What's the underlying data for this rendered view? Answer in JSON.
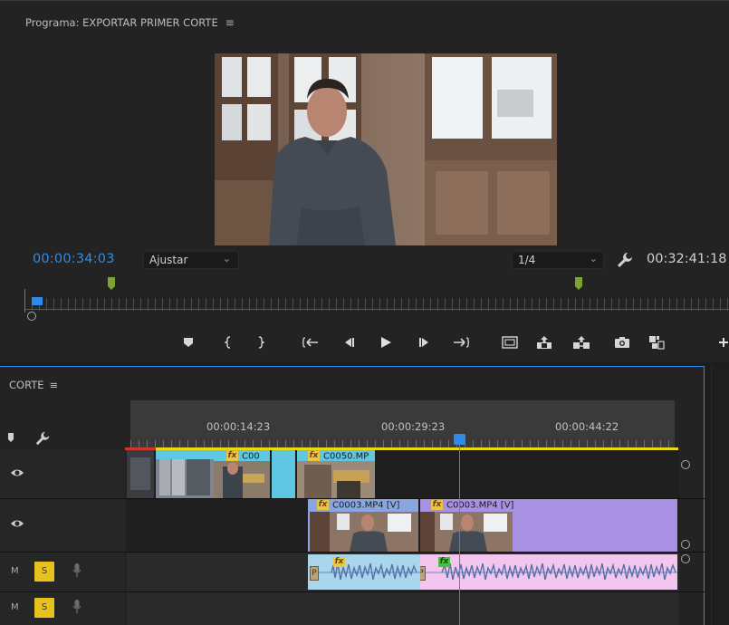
{
  "program_monitor": {
    "title": "Programa: EXPORTAR PRIMER CORTE",
    "menu_icon": "≡",
    "current_timecode": "00:00:34:03",
    "fit_value": "Ajustar",
    "resolution_value": "1/4",
    "duration_timecode": "00:32:41:18"
  },
  "transport": {
    "icons": [
      "add-marker-icon",
      "mark-in-icon",
      "mark-out-icon",
      "go-to-in-icon",
      "step-back-icon",
      "play-icon",
      "step-forward-icon",
      "go-to-out-icon",
      "safe-margins-icon",
      "lift-icon",
      "extract-icon",
      "export-frame-icon",
      "button-editor-icon",
      "add-icon"
    ]
  },
  "timeline": {
    "title": "CORTE",
    "menu_icon": "≡",
    "ruler_labels": [
      "00:00:14:23",
      "00:00:29:23",
      "00:00:44:22"
    ],
    "video_clips_v2": [
      "C00",
      "C0050.MP"
    ],
    "video_clips_v1": [
      "C0003.MP4 [V]",
      "C0003.MP4 [V]"
    ],
    "audio_tracks": [
      {
        "m_label": "M",
        "s_label": "S"
      },
      {
        "m_label": "M",
        "s_label": "S"
      }
    ],
    "audio_keyframe_label": "P"
  },
  "colors": {
    "accent_blue": "#2d8ceb",
    "work_area_yellow": "#e8d818",
    "v2_clip_cyan": "#5fc7e2",
    "v1_clip_blue": "#8aa6e0",
    "v1_clip_purple": "#a891e3",
    "audio_clip_pink": "#f3c6ef",
    "solo_yellow": "#e7c21d",
    "marker_green": "#7da432"
  }
}
